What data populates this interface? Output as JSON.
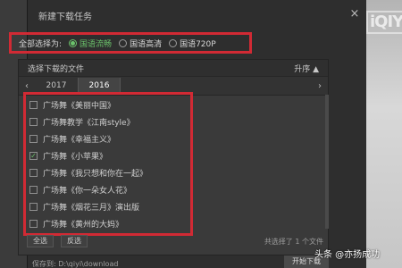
{
  "dialog": {
    "title": "新建下载任务",
    "close_glyph": "×"
  },
  "quality": {
    "label": "全部选择为:",
    "options": [
      {
        "label": "国语流畅",
        "selected": true
      },
      {
        "label": "国语高清",
        "selected": false
      },
      {
        "label": "国语720P",
        "selected": false
      }
    ]
  },
  "panel": {
    "header_label": "选择下载的文件",
    "sort_label": "升序",
    "sort_glyph": "▲",
    "years": [
      "2017",
      "2016"
    ],
    "active_year": "2016",
    "prev_glyph": "‹",
    "next_glyph": "›"
  },
  "files": [
    {
      "label": "广场舞《美丽中国》",
      "checked": false
    },
    {
      "label": "广场舞教学《江南style》",
      "checked": false
    },
    {
      "label": "广场舞《幸福主义》",
      "checked": false
    },
    {
      "label": "广场舞《小苹果》",
      "checked": true
    },
    {
      "label": "广场舞《我只想和你在一起》",
      "checked": false
    },
    {
      "label": "广场舞《你一朵女人花》",
      "checked": false
    },
    {
      "label": "广场舞《烟花三月》演出版",
      "checked": false
    },
    {
      "label": "广场舞《黄州的大妈》",
      "checked": false
    }
  ],
  "footer": {
    "select_all": "全选",
    "invert": "反选",
    "total_text": "共选择了 1 个文件"
  },
  "bottom": {
    "save_path": "保存到:  D:\\qiyi\\download",
    "download_button": "开始下载"
  },
  "watermark": {
    "text": "iQIY"
  },
  "credit": {
    "text": "头条 @亦扬成功"
  },
  "colors": {
    "accent_green": "#6bc26b",
    "highlight_red": "#d12a34"
  }
}
